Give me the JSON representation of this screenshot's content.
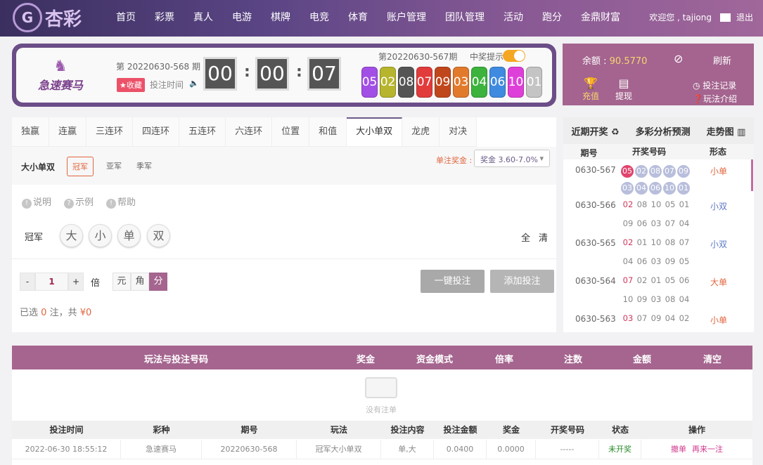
{
  "header": {
    "logo_text": "杏彩",
    "logo_mark": "G",
    "nav": [
      "首页",
      "彩票",
      "真人",
      "电游",
      "棋牌",
      "电竞",
      "体育",
      "账户管理",
      "团队管理",
      "活动",
      "跑分",
      "金鼎财富"
    ],
    "welcome": "欢迎您 , tajiong",
    "logout": "退出"
  },
  "lottery": {
    "name": "急速赛马",
    "current_issue": "第 20220630-568 期",
    "favorite": "★收藏",
    "bet_time_label": "投注时间",
    "timer": {
      "h": "00",
      "m": "00",
      "s": "07"
    },
    "prev_issue": "第20220630-567期",
    "win_remind": "中奖提示",
    "win_remind_on": true,
    "balls": [
      {
        "n": "05",
        "c": "#a24fe6"
      },
      {
        "n": "02",
        "c": "#b7b52e"
      },
      {
        "n": "08",
        "c": "#555555"
      },
      {
        "n": "07",
        "c": "#e23b3b"
      },
      {
        "n": "09",
        "c": "#c0471c"
      },
      {
        "n": "03",
        "c": "#e27a2c"
      },
      {
        "n": "04",
        "c": "#3cb33c"
      },
      {
        "n": "06",
        "c": "#3f8be0"
      },
      {
        "n": "10",
        "c": "#df3fd9"
      },
      {
        "n": "01",
        "c": "#c4c4c4"
      }
    ]
  },
  "account": {
    "balance_label": "余额 : ",
    "balance": "90.5770",
    "refresh": "刷新",
    "recharge": "充值",
    "withdraw": "提现",
    "bet_record": "投注记录",
    "play_intro": "玩法介绍"
  },
  "bet": {
    "tabs": [
      "独赢",
      "连赢",
      "三连环",
      "四连环",
      "五连环",
      "六连环",
      "位置",
      "和值",
      "大小单双",
      "龙虎",
      "对决"
    ],
    "active_tab": 8,
    "sub_title": "大小单双",
    "positions": [
      "冠军",
      "亚军",
      "季军"
    ],
    "prize_label": "单注奖金 :",
    "prize_select": "奖金 3.60-7.0%",
    "help": [
      "说明",
      "示例",
      "帮助"
    ],
    "row_label": "冠军",
    "choices": [
      "大",
      "小",
      "单",
      "双"
    ],
    "all": "全",
    "clear": "清",
    "multiplier": "1",
    "times": "倍",
    "units": [
      "元",
      "角",
      "分"
    ],
    "one_click": "一键投注",
    "add_bet": "添加投注",
    "summary": {
      "a": "已选",
      "count": "0",
      "b": "注，共",
      "amount": "¥0"
    }
  },
  "draws": {
    "tabs": [
      "近期开奖 ♻",
      "多彩分析预测",
      "走势图 ▥"
    ],
    "cols": [
      "期号",
      "开奖号码",
      "形态"
    ],
    "rows": [
      {
        "issue": "0630-567",
        "nums": [
          "05",
          "02",
          "08",
          "07",
          "09",
          "03",
          "04",
          "06",
          "10",
          "01"
        ],
        "form": "小单",
        "color": "#e0663e"
      },
      {
        "issue": "0630-566",
        "nums": [
          "02",
          "08",
          "10",
          "05",
          "01",
          "09",
          "06",
          "03",
          "07",
          "04"
        ],
        "form": "小双",
        "color": "#5b78c2"
      },
      {
        "issue": "0630-565",
        "nums": [
          "02",
          "01",
          "10",
          "08",
          "07",
          "04",
          "06",
          "03",
          "09",
          "05"
        ],
        "form": "小双",
        "color": "#5b78c2"
      },
      {
        "issue": "0630-564",
        "nums": [
          "07",
          "02",
          "01",
          "05",
          "06",
          "10",
          "09",
          "03",
          "08",
          "04"
        ],
        "form": "大单",
        "color": "#e0663e"
      },
      {
        "issue": "0630-563",
        "nums": [
          "03",
          "07",
          "09",
          "04",
          "02"
        ],
        "form": "小单",
        "color": "#e0663e"
      }
    ]
  },
  "cart": {
    "headers": [
      "玩法与投注号码",
      "奖金",
      "资金模式",
      "倍率",
      "注数",
      "金额",
      "清空"
    ],
    "empty": "没有注单"
  },
  "records": {
    "headers": [
      "投注时间",
      "彩种",
      "期号",
      "玩法",
      "投注内容",
      "投注金额",
      "奖金",
      "开奖号码",
      "状态",
      "操作"
    ],
    "rows": [
      {
        "time": "2022-06-30 18:55:12",
        "lottery": "急速赛马",
        "issue": "20220630-568",
        "play": "冠军大小单双",
        "content": "单,大",
        "amount": "0.0400",
        "prize": "0.0000",
        "numbers": "-----",
        "status": "未开奖",
        "cancel": "撤单",
        "again": "再来一注"
      }
    ]
  }
}
